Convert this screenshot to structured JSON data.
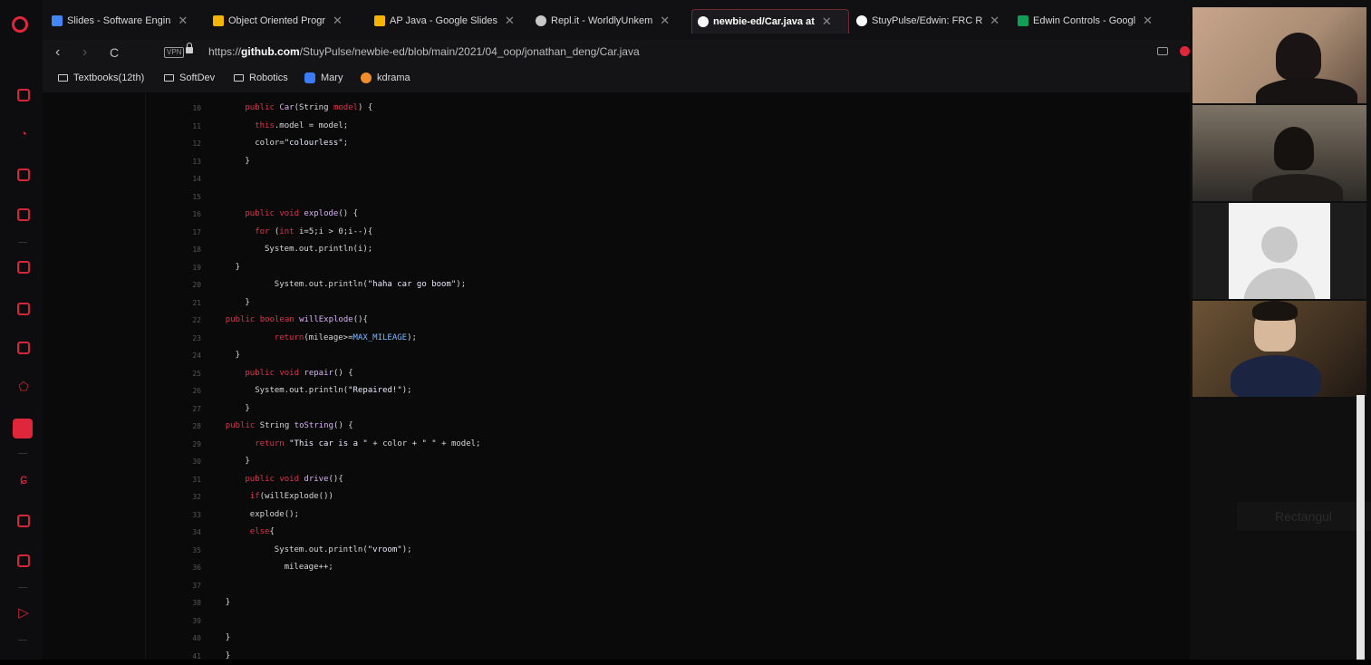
{
  "browser": {
    "tabs": [
      {
        "label": "Slides - Software Engin",
        "icon": "google-slides-icon",
        "color": "#4285f4"
      },
      {
        "label": "Object Oriented Progr",
        "icon": "google-slides-icon",
        "color": "#f4b400"
      },
      {
        "label": "AP Java - Google Slides",
        "icon": "google-slides-icon",
        "color": "#f4b400"
      },
      {
        "label": "Repl.it - WorldlyUnkem",
        "icon": "replit-icon",
        "color": "#c8c8c8"
      },
      {
        "label": "newbie-ed/Car.java at",
        "icon": "github-icon",
        "color": "#ffffff"
      },
      {
        "label": "StuyPulse/Edwin: FRC R",
        "icon": "github-icon",
        "color": "#ffffff"
      },
      {
        "label": "Edwin Controls - Googl",
        "icon": "google-sheets-icon",
        "color": "#0f9d58"
      }
    ],
    "active_tab_index": 4,
    "url_prefix": "https://",
    "url_host": "github.com",
    "url_path": "/StuyPulse/newbie-ed/blob/main/2021/04_oop/jonathan_deng/Car.java",
    "vpn_label": "VPN",
    "bookmarks": [
      {
        "label": "Textbooks(12th)",
        "type": "folder"
      },
      {
        "label": "SoftDev",
        "type": "folder"
      },
      {
        "label": "Robotics",
        "type": "folder"
      },
      {
        "label": "Mary",
        "type": "site",
        "color": "#3b7cf5"
      },
      {
        "label": "kdrama",
        "type": "site",
        "color": "#f08c2a"
      }
    ]
  },
  "code": {
    "lines": [
      {
        "n": "10",
        "indent": 6,
        "tokens": [
          [
            "kw",
            "public "
          ],
          [
            "fn",
            "Car"
          ],
          [
            "",
            "(String "
          ],
          [
            "kw",
            "model"
          ],
          [
            "",
            ") {"
          ]
        ]
      },
      {
        "n": "11",
        "indent": 8,
        "tokens": [
          [
            "kw",
            "this"
          ],
          [
            "",
            ".model = model;"
          ]
        ]
      },
      {
        "n": "12",
        "indent": 8,
        "tokens": [
          [
            "",
            "color="
          ],
          [
            "str",
            "\"colourless\""
          ],
          [
            "",
            ";"
          ]
        ]
      },
      {
        "n": "13",
        "indent": 6,
        "tokens": [
          [
            "",
            "}"
          ]
        ]
      },
      {
        "n": "14",
        "indent": 0,
        "tokens": []
      },
      {
        "n": "15",
        "indent": 0,
        "tokens": []
      },
      {
        "n": "16",
        "indent": 6,
        "tokens": [
          [
            "kw",
            "public void "
          ],
          [
            "fn",
            "explode"
          ],
          [
            "",
            "() {"
          ]
        ]
      },
      {
        "n": "17",
        "indent": 8,
        "tokens": [
          [
            "kw",
            "for "
          ],
          [
            "",
            "("
          ],
          [
            "kw",
            "int "
          ],
          [
            "",
            "i=5;i > 0;i--){"
          ]
        ]
      },
      {
        "n": "18",
        "indent": 10,
        "tokens": [
          [
            "",
            "System.out.println(i);"
          ]
        ]
      },
      {
        "n": "19",
        "indent": 4,
        "tokens": [
          [
            "",
            "}"
          ]
        ]
      },
      {
        "n": "20",
        "indent": 12,
        "tokens": [
          [
            "",
            "System.out.println("
          ],
          [
            "str",
            "\"haha car go boom\""
          ],
          [
            "",
            ");"
          ]
        ]
      },
      {
        "n": "21",
        "indent": 6,
        "tokens": [
          [
            "",
            "}"
          ]
        ]
      },
      {
        "n": "22",
        "indent": 2,
        "tokens": [
          [
            "kw",
            "public boolean "
          ],
          [
            "fn",
            "willExplode"
          ],
          [
            "",
            "(){"
          ]
        ]
      },
      {
        "n": "23",
        "indent": 12,
        "tokens": [
          [
            "kw",
            "return"
          ],
          [
            "",
            "(mileage>="
          ],
          [
            "const",
            "MAX_MILEAGE"
          ],
          [
            "",
            ");"
          ]
        ]
      },
      {
        "n": "24",
        "indent": 4,
        "tokens": [
          [
            "",
            "}"
          ]
        ]
      },
      {
        "n": "25",
        "indent": 6,
        "tokens": [
          [
            "kw",
            "public void "
          ],
          [
            "fn",
            "repair"
          ],
          [
            "",
            "() {"
          ]
        ]
      },
      {
        "n": "26",
        "indent": 8,
        "tokens": [
          [
            "",
            "System.out.println("
          ],
          [
            "str",
            "\"Repaired!\""
          ],
          [
            "",
            ");"
          ]
        ]
      },
      {
        "n": "27",
        "indent": 6,
        "tokens": [
          [
            "",
            "}"
          ]
        ]
      },
      {
        "n": "28",
        "indent": 2,
        "tokens": [
          [
            "kw",
            "public "
          ],
          [
            "",
            "String "
          ],
          [
            "fn",
            "toString"
          ],
          [
            "",
            "() {"
          ]
        ]
      },
      {
        "n": "29",
        "indent": 8,
        "tokens": [
          [
            "kw",
            "return "
          ],
          [
            "str",
            "\"This car is a \""
          ],
          [
            "",
            " + color + "
          ],
          [
            "str",
            "\" \""
          ],
          [
            "",
            " + model;"
          ]
        ]
      },
      {
        "n": "30",
        "indent": 6,
        "tokens": [
          [
            "",
            "}"
          ]
        ]
      },
      {
        "n": "31",
        "indent": 6,
        "tokens": [
          [
            "kw",
            "public void "
          ],
          [
            "fn",
            "drive"
          ],
          [
            "",
            "(){"
          ]
        ]
      },
      {
        "n": "32",
        "indent": 7,
        "tokens": [
          [
            "kw",
            "if"
          ],
          [
            "",
            "(willExplode())"
          ]
        ]
      },
      {
        "n": "33",
        "indent": 7,
        "tokens": [
          [
            "",
            "explode();"
          ]
        ]
      },
      {
        "n": "34",
        "indent": 7,
        "tokens": [
          [
            "kw",
            "else"
          ],
          [
            "",
            "{"
          ]
        ]
      },
      {
        "n": "35",
        "indent": 12,
        "tokens": [
          [
            "",
            "System.out.println("
          ],
          [
            "str",
            "\"vroom\""
          ],
          [
            "",
            ");"
          ]
        ]
      },
      {
        "n": "36",
        "indent": 14,
        "tokens": [
          [
            "",
            "mileage++;"
          ]
        ]
      },
      {
        "n": "37",
        "indent": 0,
        "tokens": []
      },
      {
        "n": "38",
        "indent": 2,
        "tokens": [
          [
            "",
            "}"
          ]
        ]
      },
      {
        "n": "39",
        "indent": 0,
        "tokens": []
      },
      {
        "n": "40",
        "indent": 2,
        "tokens": [
          [
            "",
            "}"
          ]
        ]
      },
      {
        "n": "41",
        "indent": 2,
        "tokens": [
          [
            "",
            "}"
          ]
        ]
      }
    ]
  },
  "video_call": {
    "participants": [
      {
        "kind": "camera",
        "person_tone": "#1a1414"
      },
      {
        "kind": "camera",
        "person_tone": "#15120f"
      },
      {
        "kind": "avatar"
      },
      {
        "kind": "camera",
        "person_tone": "#1b2440"
      }
    ],
    "overlay_label": "Rectangul"
  }
}
